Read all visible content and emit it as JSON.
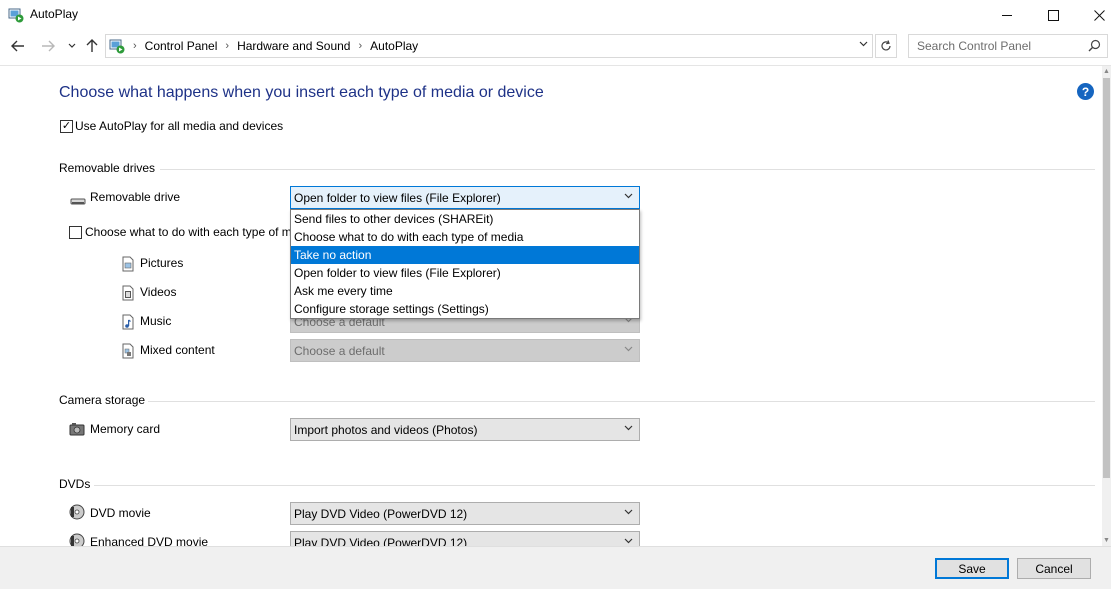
{
  "window": {
    "title": "AutoPlay"
  },
  "nav": {
    "breadcrumbs": [
      "Control Panel",
      "Hardware and Sound",
      "AutoPlay"
    ],
    "search_placeholder": "Search Control Panel"
  },
  "page": {
    "heading": "Choose what happens when you insert each type of media or device",
    "use_autoplay_label": "Use AutoPlay for all media and devices",
    "use_autoplay_checked": true
  },
  "removable": {
    "section_title": "Removable drives",
    "drive_label": "Removable drive",
    "drive_value": "Open folder to view files (File Explorer)",
    "dropdown_options": [
      "Send files to other devices (SHAREit)",
      "Choose what to do with each type of media",
      "Take no action",
      "Open folder to view files (File Explorer)",
      "Ask me every time",
      "Configure storage settings (Settings)"
    ],
    "dropdown_highlighted": "Take no action",
    "each_type_label": "Choose what to do with each type of m",
    "each_type_checked": false,
    "media": [
      {
        "label": "Pictures",
        "icon": "pictures-icon"
      },
      {
        "label": "Videos",
        "icon": "videos-icon"
      },
      {
        "label": "Music",
        "icon": "music-icon"
      },
      {
        "label": "Mixed content",
        "icon": "mixed-content-icon"
      }
    ],
    "partial_default_text": "Choose a default",
    "mixed_default_text": "Choose a default"
  },
  "camera": {
    "section_title": "Camera storage",
    "memory_card_label": "Memory card",
    "memory_card_value": "Import photos and videos (Photos)"
  },
  "dvds": {
    "section_title": "DVDs",
    "dvd_movie_label": "DVD movie",
    "dvd_movie_value": "Play DVD Video (PowerDVD 12)",
    "enhanced_label": "Enhanced DVD movie",
    "enhanced_value": "Play DVD Video (PowerDVD 12)"
  },
  "footer": {
    "save_label": "Save",
    "cancel_label": "Cancel"
  },
  "colors": {
    "heading": "#1e3287",
    "accent": "#0078d7",
    "help": "#1565c0"
  }
}
